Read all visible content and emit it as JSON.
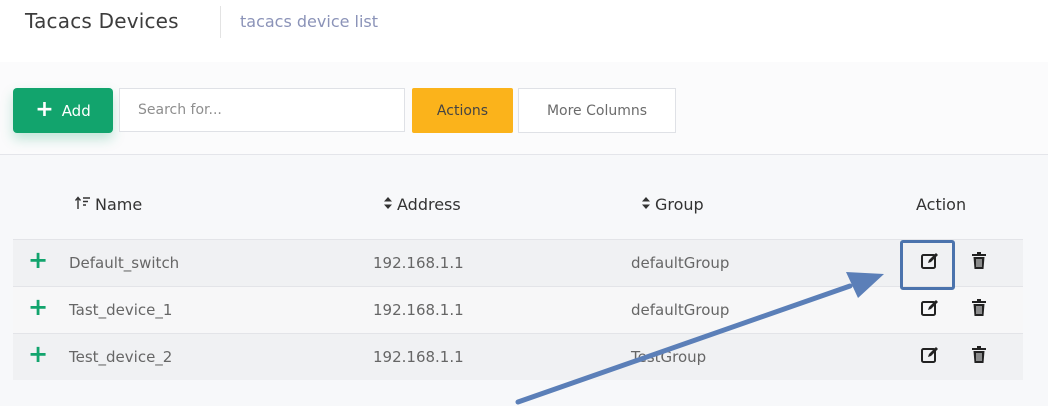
{
  "header": {
    "title": "Tacacs Devices",
    "subtitle": "tacacs device list"
  },
  "toolbar": {
    "add_label": "Add",
    "search_placeholder": "Search for...",
    "actions_label": "Actions",
    "more_columns_label": "More Columns"
  },
  "table": {
    "columns": [
      "Name",
      "Address",
      "Group",
      "Action"
    ],
    "rows": [
      {
        "name": "Default_switch",
        "address": "192.168.1.1",
        "group": "defaultGroup"
      },
      {
        "name": "Tast_device_1",
        "address": "192.168.1.1",
        "group": "defaultGroup"
      },
      {
        "name": "Test_device_2",
        "address": "192.168.1.1",
        "group": "TestGroup"
      }
    ]
  },
  "icons": {
    "add": "plus-icon",
    "sort_name": "sort-ascending-icon",
    "sort_other": "sort-icon",
    "expand": "plus-icon",
    "edit": "edit-icon",
    "delete": "trash-icon"
  },
  "colors": {
    "primary_green": "#12a46d",
    "actions_yellow": "#fbb31b",
    "subtitle": "#8b93b8",
    "highlight": "#4b73ad"
  }
}
